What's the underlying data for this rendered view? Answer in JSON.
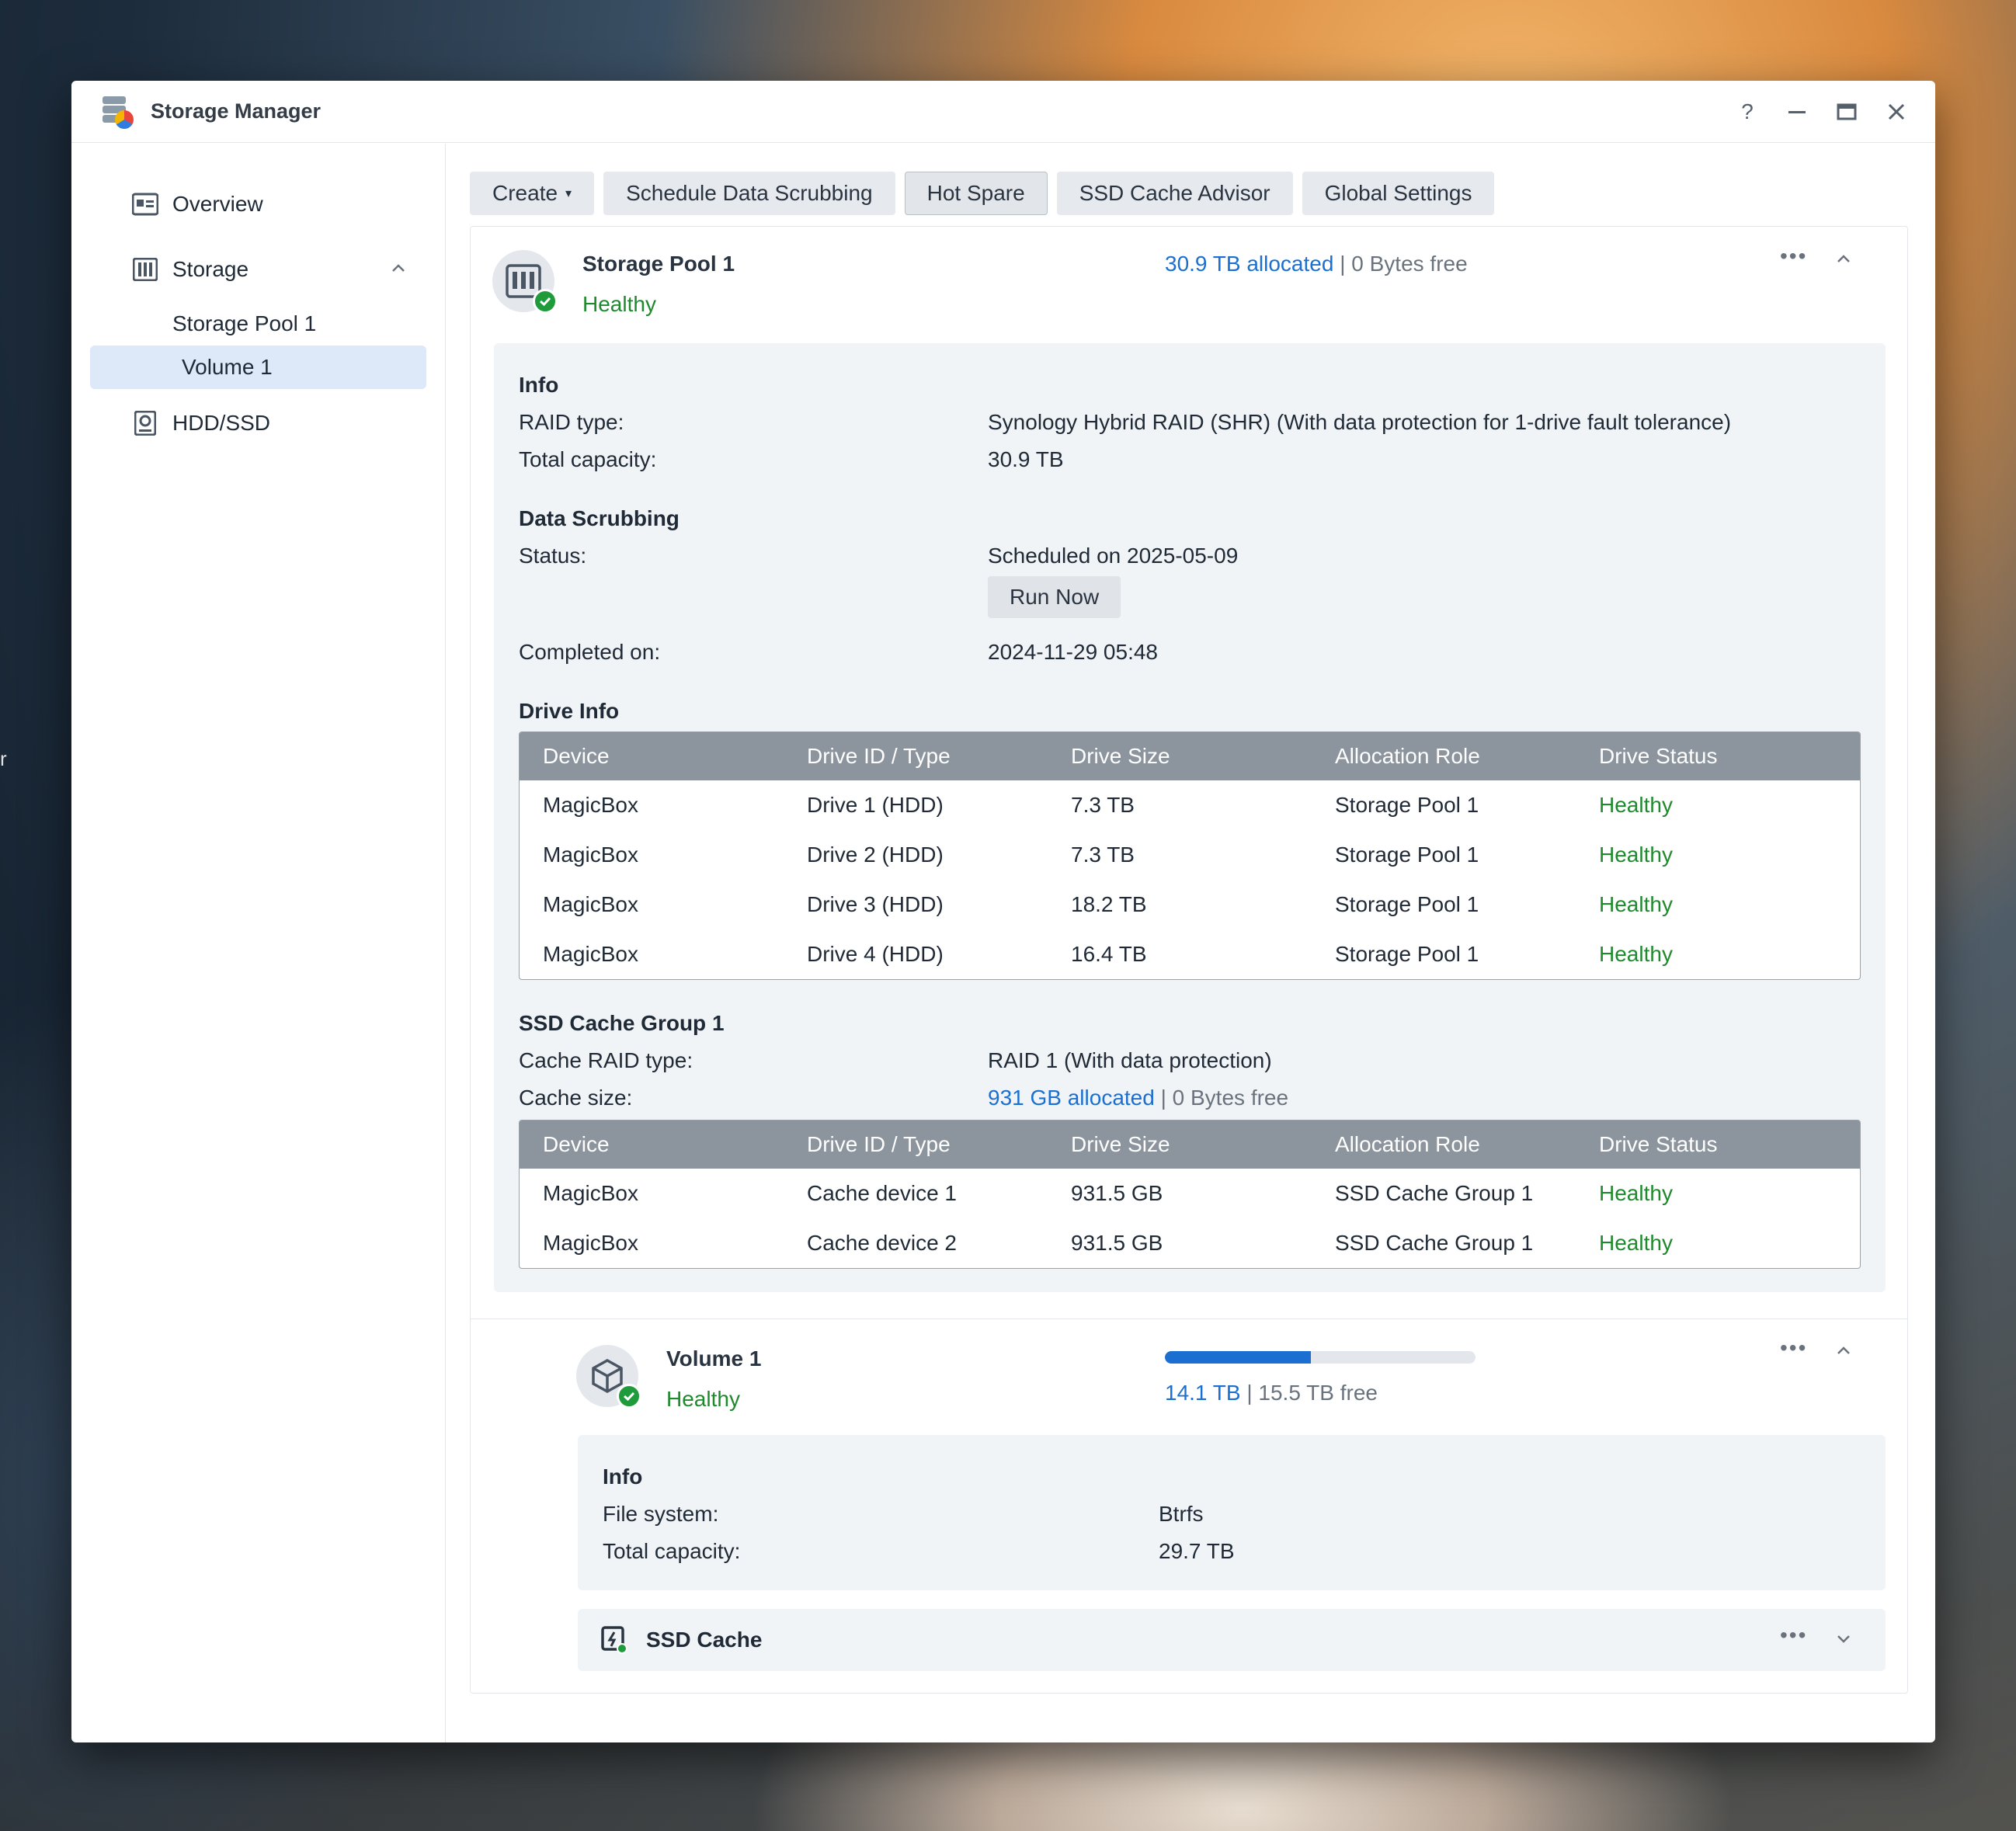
{
  "window": {
    "title": "Storage Manager"
  },
  "background": {
    "edge_text": "r"
  },
  "sidebar": {
    "items": [
      {
        "label": "Overview",
        "icon": "overview-icon"
      },
      {
        "label": "Storage",
        "icon": "storage-icon",
        "expanded": true
      },
      {
        "label": "Storage Pool 1"
      },
      {
        "label": "Volume 1",
        "selected": true
      },
      {
        "label": "HDD/SSD",
        "icon": "hdd-icon"
      }
    ]
  },
  "toolbar": {
    "create": "Create",
    "schedule": "Schedule Data Scrubbing",
    "hot_spare": "Hot Spare",
    "ssd_advisor": "SSD Cache Advisor",
    "global_settings": "Global Settings"
  },
  "pool": {
    "name": "Storage Pool 1",
    "status": "Healthy",
    "allocated": "30.9 TB allocated",
    "sep": "|",
    "free": "0 Bytes free",
    "info_title": "Info",
    "raid_label": "RAID type:",
    "raid_value": "Synology Hybrid RAID (SHR) (With data protection for 1-drive fault tolerance)",
    "capacity_label": "Total capacity:",
    "capacity_value": "30.9 TB",
    "scrub_title": "Data Scrubbing",
    "scrub_status_label": "Status:",
    "scrub_status_value": "Scheduled on 2025-05-09",
    "run_now": "Run Now",
    "completed_label": "Completed on:",
    "completed_value": "2024-11-29 05:48",
    "drive_info_title": "Drive Info"
  },
  "drive_table": {
    "headers": [
      "Device",
      "Drive ID / Type",
      "Drive Size",
      "Allocation Role",
      "Drive Status"
    ],
    "rows": [
      [
        "MagicBox",
        "Drive 1 (HDD)",
        "7.3 TB",
        "Storage Pool 1",
        "Healthy"
      ],
      [
        "MagicBox",
        "Drive 2 (HDD)",
        "7.3 TB",
        "Storage Pool 1",
        "Healthy"
      ],
      [
        "MagicBox",
        "Drive 3 (HDD)",
        "18.2 TB",
        "Storage Pool 1",
        "Healthy"
      ],
      [
        "MagicBox",
        "Drive 4 (HDD)",
        "16.4 TB",
        "Storage Pool 1",
        "Healthy"
      ]
    ]
  },
  "cache_group": {
    "title": "SSD Cache Group 1",
    "raid_label": "Cache RAID type:",
    "raid_value": "RAID 1 (With data protection)",
    "size_label": "Cache size:",
    "allocated": "931 GB allocated",
    "sep": "|",
    "free": "0 Bytes free"
  },
  "cache_table": {
    "headers": [
      "Device",
      "Drive ID / Type",
      "Drive Size",
      "Allocation Role",
      "Drive Status"
    ],
    "rows": [
      [
        "MagicBox",
        "Cache device 1",
        "931.5 GB",
        "SSD Cache Group 1",
        "Healthy"
      ],
      [
        "MagicBox",
        "Cache device 2",
        "931.5 GB",
        "SSD Cache Group 1",
        "Healthy"
      ]
    ]
  },
  "volume": {
    "name": "Volume 1",
    "status": "Healthy",
    "used": "14.1 TB",
    "sep": "|",
    "free": "15.5 TB free",
    "usage_fraction": 0.47,
    "info_title": "Info",
    "fs_label": "File system:",
    "fs_value": "Btrfs",
    "capacity_label": "Total capacity:",
    "capacity_value": "29.7 TB"
  },
  "ssd_cache": {
    "title": "SSD Cache"
  },
  "colors": {
    "accent": "#1a6fd1",
    "healthy": "#1d8a2c",
    "table_header": "#8c949d"
  }
}
